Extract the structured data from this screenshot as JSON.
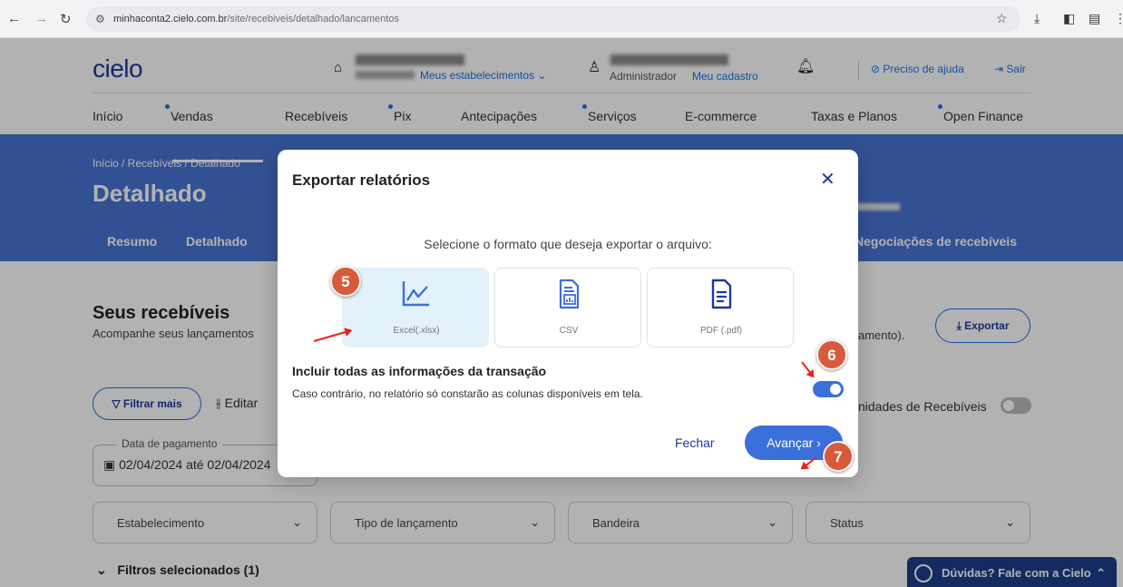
{
  "browser": {
    "url_host": "minhaconta2.cielo.com.br",
    "url_path": "/site/recebiveis/detalhado/lancamentos"
  },
  "header": {
    "logo": "cielo",
    "stores_link": "Meus estabelecimentos",
    "user_role": "Administrador",
    "user_link": "Meu cadastro",
    "help_link": "Preciso de ajuda",
    "exit_link": "Sair"
  },
  "menu": [
    "Início",
    "Vendas",
    "Recebíveis",
    "Pix",
    "Antecipações",
    "Serviços",
    "E-commerce",
    "Taxas e Planos",
    "Open Finance"
  ],
  "hero": {
    "breadcrumb": "Início  /  Recebíveis  /  Detalhado",
    "title": "Detalhado",
    "tabs": [
      "Resumo",
      "Detalhado",
      "Negociações de recebíveis"
    ]
  },
  "main": {
    "section_title": "Seus recebíveis",
    "section_sub": "Acompanhe seus lançamentos",
    "section_sub_right": "amento).",
    "export_label": "Exportar",
    "filter_label": "Filtrar mais",
    "edit_label": "Editar",
    "opp_label": "nidades de Recebíveis",
    "date_label": "Data de pagamento",
    "date_value": "02/04/2024 até 02/04/2024",
    "dropdowns": [
      "Estabelecimento",
      "Tipo de lançamento",
      "Bandeira",
      "Status"
    ],
    "filters_selected": "Filtros selecionados (1)"
  },
  "chat": {
    "label": "Dúvidas? Fale com a Cielo"
  },
  "modal": {
    "title": "Exportar relatórios",
    "prompt": "Selecione o formato que deseja exportar o arquivo:",
    "formats": [
      {
        "label": "Excel(.xlsx)",
        "icon": "chart-line-icon",
        "selected": true
      },
      {
        "label": "CSV",
        "icon": "csv-file-icon",
        "selected": false
      },
      {
        "label": "PDF (.pdf)",
        "icon": "document-icon",
        "selected": false
      }
    ],
    "include_title": "Incluir todas as informações da transação",
    "include_sub": "Caso contrário, no relatório só constarão as colunas disponíveis em tela.",
    "include_enabled": true,
    "close_label": "Fechar",
    "next_label": "Avançar"
  },
  "annotations": [
    "5",
    "6",
    "7"
  ],
  "colors": {
    "brand_blue": "#4874d4",
    "accent": "#3b6fdc",
    "badge": "#d75b3b"
  }
}
